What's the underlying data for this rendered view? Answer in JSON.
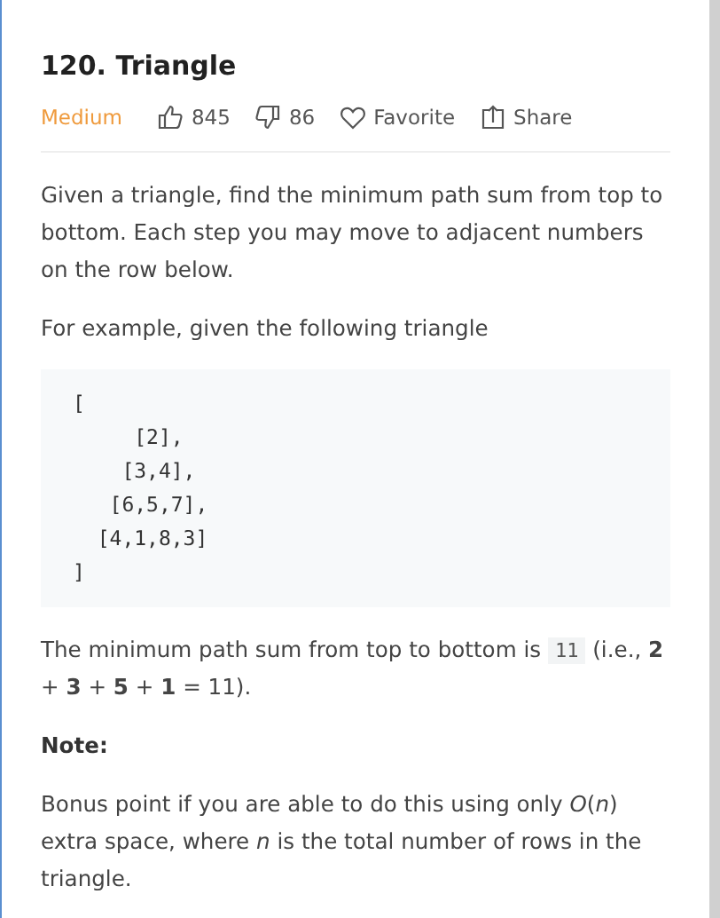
{
  "title": "120. Triangle",
  "difficulty": "Medium",
  "likes": "845",
  "dislikes": "86",
  "actions": [
    {
      "kind": "favorite",
      "label": "Favorite"
    },
    {
      "kind": "share",
      "label": "Share"
    }
  ],
  "description": "Given a triangle, find the minimum path sum from top to bottom. Each step you may move to adjacent numbers on the row below.",
  "example_intro": "For example, given the following triangle",
  "code_block": "[\n     [2],\n    [3,4],\n   [6,5,7],\n  [4,1,8,3]\n]",
  "result": {
    "before": "The minimum path sum from top to bottom is",
    "code": "11",
    "after": "(i.e., **2** + **3** + **5** + **1** = 11)."
  },
  "note_heading": "Note:",
  "note": "Bonus point if you are able to do this using only *O*(*n*) extra space, where *n* is the total number of rows in the triangle."
}
